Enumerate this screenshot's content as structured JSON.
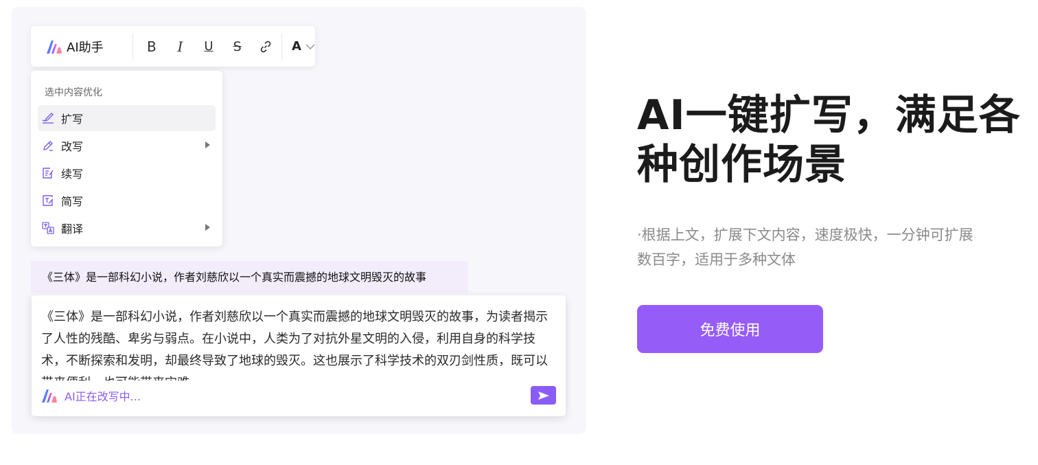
{
  "toolbar": {
    "ai_label": "AI助手",
    "buttons": {
      "bold": "B",
      "italic": "I",
      "underline": "U",
      "strike": "S",
      "color": "A"
    }
  },
  "menu": {
    "heading": "选中内容优化",
    "items": [
      {
        "label": "扩写",
        "icon": "expand-pen-icon",
        "active": true,
        "submenu": false
      },
      {
        "label": "改写",
        "icon": "pencil-icon",
        "active": false,
        "submenu": true
      },
      {
        "label": "续写",
        "icon": "continue-doc-icon",
        "active": false,
        "submenu": false
      },
      {
        "label": "简写",
        "icon": "simplify-doc-icon",
        "active": false,
        "submenu": false
      },
      {
        "label": "翻译",
        "icon": "translate-icon",
        "active": false,
        "submenu": true
      }
    ]
  },
  "editor": {
    "selected_text": "《三体》是一部科幻小说，作者刘慈欣以一个真实而震撼的地球文明毁灭的故事",
    "result_text": "《三体》是一部科幻小说，作者刘慈欣以一个真实而震撼的地球文明毁灭的故事，为读者揭示了人性的残酷、卑劣与弱点。在小说中，人类为了对抗外星文明的入侵，利用自身的科学技术，不断探索和发明，却最终导致了地球的毁灭。这也展示了科学技术的双刃剑性质，既可以带来便利，也可能带来灾难。",
    "status": "AI正在改写中..."
  },
  "hero": {
    "title_line1": "AI一键扩写，满足各",
    "title_line2": "种创作场景",
    "description": "·根据上文，扩展下文内容，速度极快，一分钟可扩展数百字，适用于多种文体",
    "cta": "免费使用"
  },
  "colors": {
    "accent": "#965cf8",
    "selection_bg": "#f2ecfb",
    "panel_bg": "#f6f6fb"
  }
}
